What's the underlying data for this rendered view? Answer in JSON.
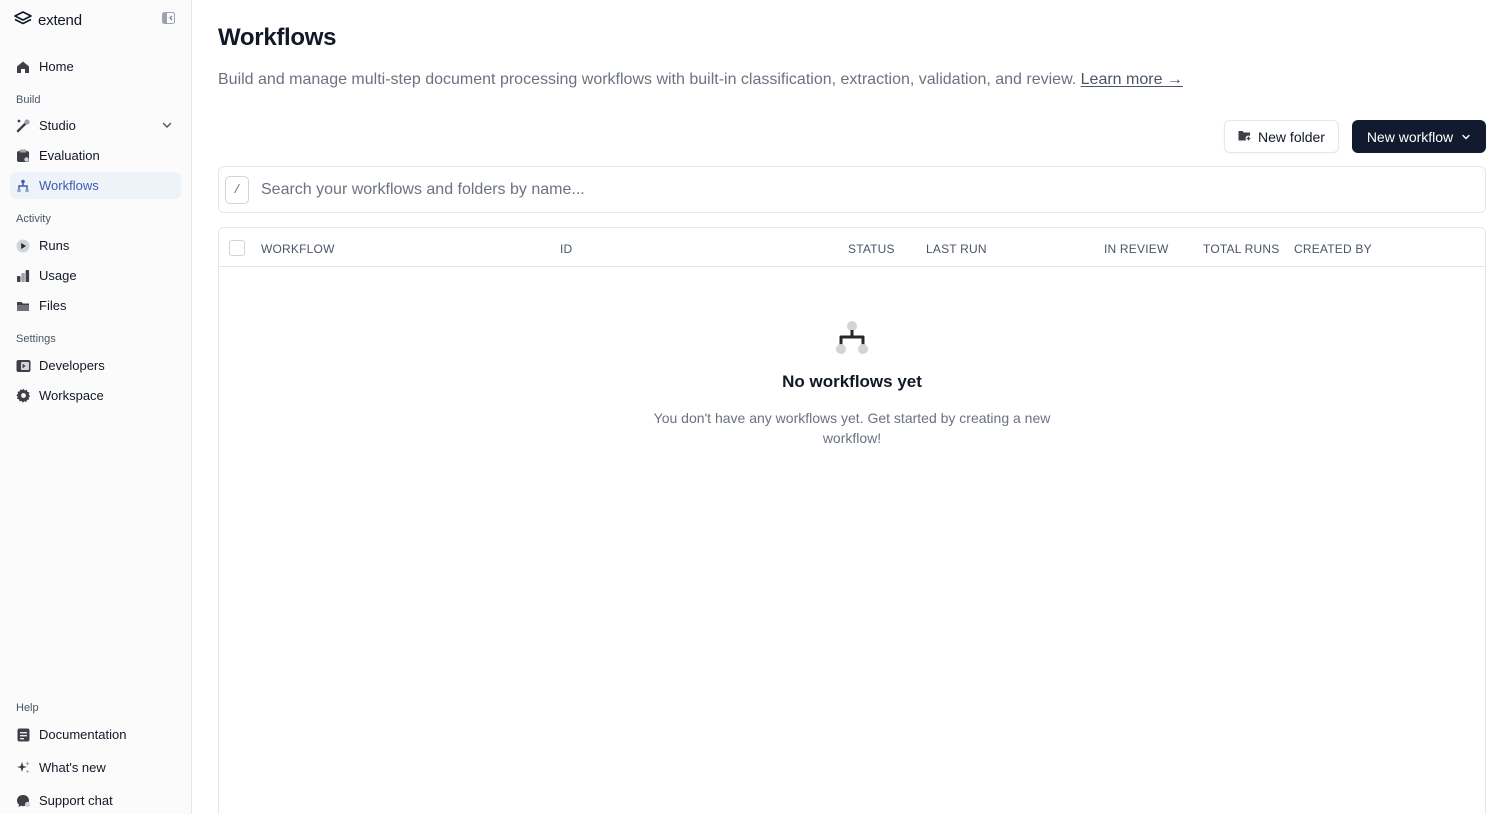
{
  "brand": {
    "name": "extend"
  },
  "sidebar": {
    "home": "Home",
    "build_label": "Build",
    "studio": "Studio",
    "evaluation": "Evaluation",
    "workflows": "Workflows",
    "activity_label": "Activity",
    "runs": "Runs",
    "usage": "Usage",
    "files": "Files",
    "settings_label": "Settings",
    "developers": "Developers",
    "workspace": "Workspace",
    "help_label": "Help",
    "documentation": "Documentation",
    "whats_new": "What's new",
    "support_chat": "Support chat"
  },
  "header": {
    "title": "Workflows",
    "description": "Build and manage multi-step document processing workflows with built-in classification, extraction, validation, and review.",
    "learn_more": "Learn more →"
  },
  "actions": {
    "new_folder": "New folder",
    "new_workflow": "New workflow"
  },
  "search": {
    "shortcut": "/",
    "placeholder": "Search your workflows and folders by name..."
  },
  "table": {
    "columns": {
      "workflow": "WORKFLOW",
      "id": "ID",
      "status": "STATUS",
      "last_run": "LAST RUN",
      "in_review": "IN REVIEW",
      "total_runs": "TOTAL RUNS",
      "created_by": "CREATED BY"
    }
  },
  "empty_state": {
    "title": "No workflows yet",
    "text": "You don't have any workflows yet. Get started by creating a new workflow!"
  },
  "colors": {
    "active_nav_bg": "#eef2f9",
    "active_nav_text": "#3b5bb5",
    "primary_button": "#111a2e"
  }
}
